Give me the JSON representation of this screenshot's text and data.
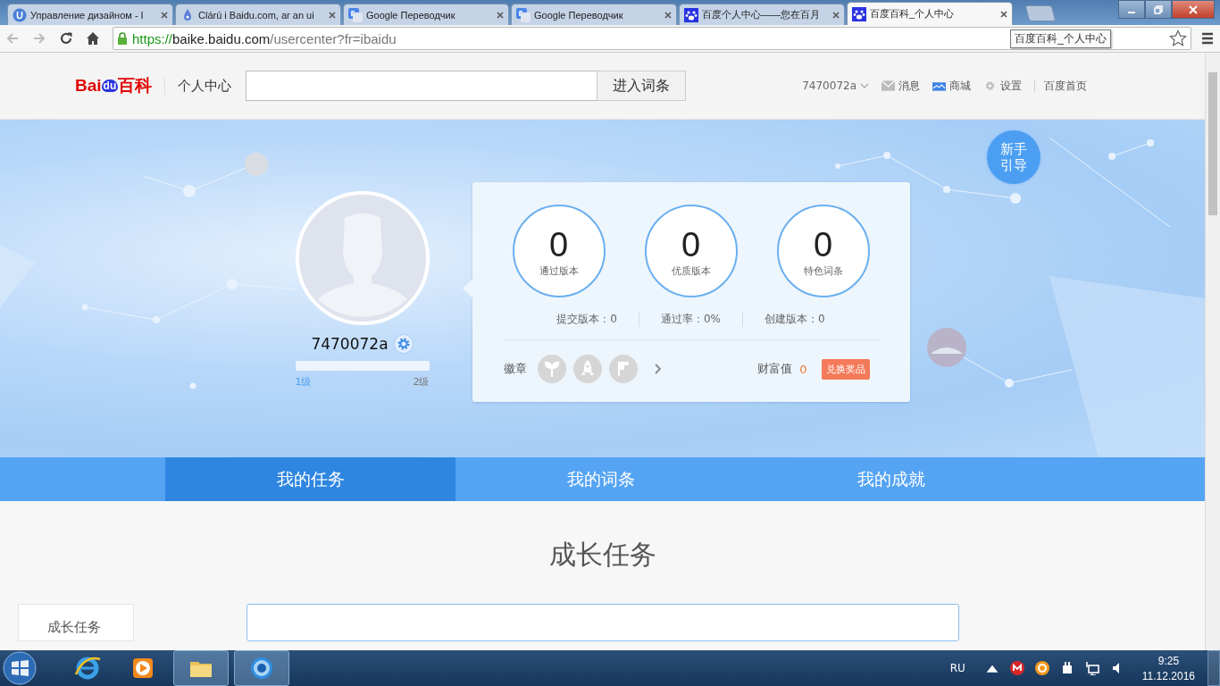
{
  "browser": {
    "tabs": [
      {
        "title": "Управление дизайном - I",
        "kind": "u",
        "selected": false
      },
      {
        "title": "Clárú i Baidu.com, ar an ui",
        "kind": "drop",
        "selected": false
      },
      {
        "title": "Google Переводчик",
        "kind": "translate",
        "selected": false
      },
      {
        "title": "Google Переводчик",
        "kind": "translate",
        "selected": false
      },
      {
        "title": "百度个人中心——您在百月",
        "kind": "paw",
        "selected": false
      },
      {
        "title": "百度百科_个人中心",
        "kind": "paw",
        "selected": true
      }
    ],
    "url": {
      "scheme": "https://",
      "host": "baike.baidu.com",
      "path": "/usercenter?fr=ibaidu"
    },
    "tooltip": "百度百科_个人中心"
  },
  "header": {
    "logo": [
      "Bai",
      "du",
      "百科"
    ],
    "section": "个人中心",
    "search_button": "进入词条",
    "user": "7470072a",
    "links": [
      {
        "label": "消息",
        "kind": "mail"
      },
      {
        "label": "商城",
        "kind": "shop"
      },
      {
        "label": "设置",
        "kind": "gear"
      },
      {
        "label": "百度首页",
        "kind": "none"
      }
    ]
  },
  "hero": {
    "guide": "新手引导",
    "profile": {
      "name": "7470072a",
      "level": 0,
      "level_from": "1级",
      "level_to": "2级"
    },
    "stats": [
      {
        "value": "0",
        "label": "通过版本"
      },
      {
        "value": "0",
        "label": "优质版本"
      },
      {
        "value": "0",
        "label": "特色词条"
      }
    ],
    "substats": [
      "提交版本：0",
      "通过率：0%",
      "创建版本：0"
    ],
    "badges_label": "徽章",
    "badges": [
      {
        "kind": "sprout"
      },
      {
        "kind": "rocket"
      },
      {
        "kind": "flag"
      }
    ],
    "wealth_label": "财富值",
    "wealth_value": "0",
    "redeem": "兑换奖品"
  },
  "nav": [
    {
      "label": "我的任务",
      "selected": true
    },
    {
      "label": "我的词条",
      "selected": false
    },
    {
      "label": "我的成就",
      "selected": false
    }
  ],
  "content": {
    "heading": "成长任务",
    "side_items": [
      "成长任务"
    ]
  },
  "taskbar": {
    "apps": [
      {
        "kind": "ie",
        "selected": false
      },
      {
        "kind": "media",
        "selected": false
      },
      {
        "kind": "folder",
        "selected": true
      },
      {
        "kind": "chrome",
        "selected": true
      }
    ],
    "language": "RU",
    "time": "9:25",
    "date": "11.12.2016"
  }
}
